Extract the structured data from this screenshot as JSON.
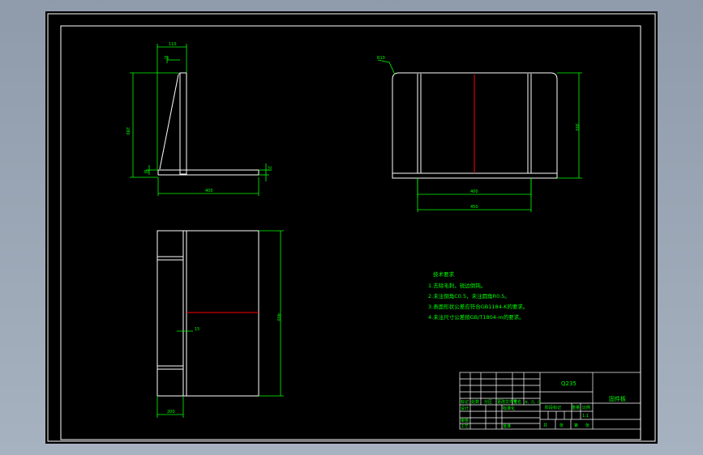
{
  "drawing": {
    "dimensions": {
      "top_width": "110",
      "top_inner": "75",
      "left_height": "280",
      "left_small": "30",
      "left_base_thk": "20",
      "left_base_len": "400",
      "front_fillet": "R10",
      "front_height": "300",
      "front_inner_width": "400",
      "front_outer_width": "450",
      "plan_mark": "15",
      "plan_height": "400",
      "plan_width": "200"
    },
    "notes": {
      "title": "技术要求",
      "items": [
        "1.去除毛刺，锐边倒钝。",
        "2.未注倒角C0.5，未注圆角R0.5。",
        "3.表面形状公差应符合GB1184-K的要求。",
        "4.未注尺寸公差按GB/T1804-m的要求。"
      ]
    },
    "title_block": {
      "material": "Q235",
      "part_name": "固件板",
      "scale": "1:1",
      "stage_mark": "阶段标记",
      "weight": "重量",
      "scale_label": "比例",
      "sheet_total": "共",
      "sheet_no": "张",
      "sheet_of": "第",
      "sheet_of_end": "张",
      "rev_mark": "标记",
      "rev_count": "处数",
      "rev_zone": "分区",
      "rev_doc": "更改文件号",
      "rev_sign": "签名",
      "rev_date": "年、月、日",
      "designer": "设计",
      "standard": "标准化",
      "reviewer": "审核",
      "process": "工艺",
      "approve": "批准"
    }
  },
  "colors": {
    "background": "#000000",
    "frame": "#ffffff",
    "dimension": "#00ff00",
    "centerline": "#ff0000",
    "page_bg": "#98a4b4"
  }
}
